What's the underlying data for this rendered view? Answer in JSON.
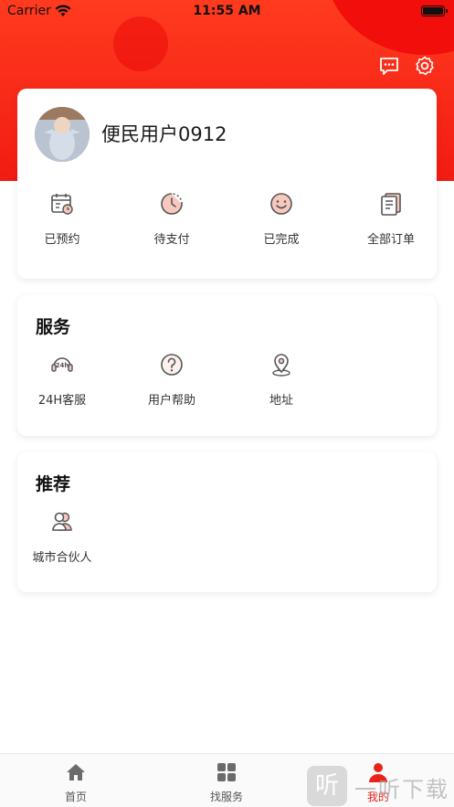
{
  "status_bar": {
    "carrier": "Carrier",
    "time": "11:55 AM"
  },
  "header": {
    "icons": [
      "message-icon",
      "settings-icon"
    ]
  },
  "profile": {
    "username": "便民用户0912",
    "orders": [
      {
        "label": "已预约",
        "icon": "calendar-clock-icon"
      },
      {
        "label": "待支付",
        "icon": "clock-pending-icon"
      },
      {
        "label": "已完成",
        "icon": "smile-icon"
      },
      {
        "label": "全部订单",
        "icon": "order-list-icon"
      }
    ]
  },
  "services": {
    "title": "服务",
    "items": [
      {
        "label": "24H客服",
        "icon": "24h-service-icon"
      },
      {
        "label": "用户帮助",
        "icon": "question-icon"
      },
      {
        "label": "地址",
        "icon": "location-pin-icon"
      }
    ]
  },
  "recommend": {
    "title": "推荐",
    "items": [
      {
        "label": "城市合伙人",
        "icon": "partner-users-icon"
      }
    ]
  },
  "tabbar": {
    "tabs": [
      {
        "label": "首页",
        "icon": "home-icon"
      },
      {
        "label": "找服务",
        "icon": "grid-icon"
      },
      {
        "label": "我的",
        "icon": "user-icon",
        "active": true
      }
    ]
  },
  "watermark": {
    "glyph": "听",
    "text": "一听下载"
  },
  "colors": {
    "accent": "#f21b12",
    "card_bg": "#ffffff",
    "icon_line": "#555555",
    "icon_fill": "#f7c9be"
  }
}
